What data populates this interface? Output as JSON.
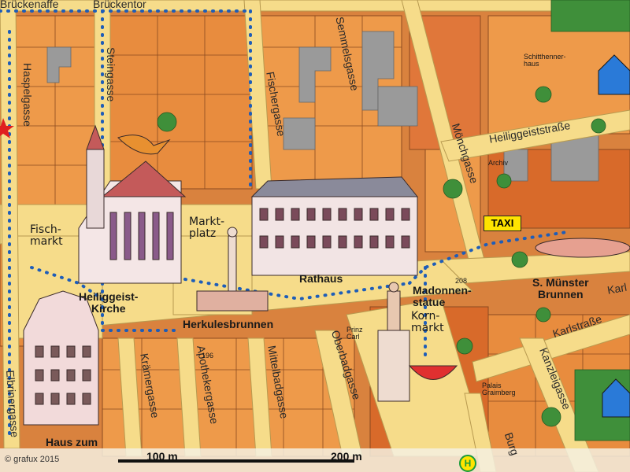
{
  "map": {
    "streets": {
      "brueckentor": "Brückentor",
      "brueckenaffe": "Brückenaffe",
      "steingasse": "Steingasse",
      "haspelgasse": "Haspelgasse",
      "fischergasse": "Fischergasse",
      "semmelsgasse": "Semmelsgasse",
      "moenchgasse": "Mönchgasse",
      "heiliggeiststrasse": "Heiliggeiststraße",
      "karlstrasse": "Karlstraße",
      "kraemergasse": "Krämergasse",
      "apothekergasse": "Apothekergasse",
      "mittelbadgasse": "Mittelbadgasse",
      "oberbadgasse": "Oberbadgasse",
      "kanzleigasse": "Kanzleigasse",
      "elbrinergasse": "Elbrinergasse",
      "burg": "Burg",
      "karl_east": "Karl"
    },
    "places": {
      "heiliggeist_kirche": "Heiliggeist-\nKirche",
      "rathaus": "Rathaus",
      "herkulesbrunnen": "Herkulesbrunnen",
      "marktplatz": "Markt-\nplatz",
      "fischmarkt": "Fisch-\nmarkt",
      "kornmarkt": "Korn-\nmarkt",
      "madonnenstatue": "Madonnen-\nstatue",
      "s_muenster_brunnen": "S. Münster\nBrunnen",
      "haus_zum": "Haus zum",
      "prinz_carl": "Prinz\nCarl",
      "schitthennerhaus": "Schitthenner-\nhaus",
      "archiv": "Archiv",
      "palais_graimberg": "Palais\nGraimberg"
    },
    "house_numbers": {
      "n196": "196",
      "n208": "208"
    },
    "taxi": "TAXI",
    "bus_icon": "bus-stop-icon",
    "bus_symbol": "H",
    "scale": {
      "label_100": "100 m",
      "label_200": "200 m"
    },
    "copyright": "© grafux 2015",
    "colors": {
      "street": "#f6dc8a",
      "building_light": "#ee9a4a",
      "building_dark": "#d86a2a",
      "gray_block": "#9a9a9a",
      "route_dot": "#1e5db8",
      "green": "#3f8f3a"
    }
  }
}
